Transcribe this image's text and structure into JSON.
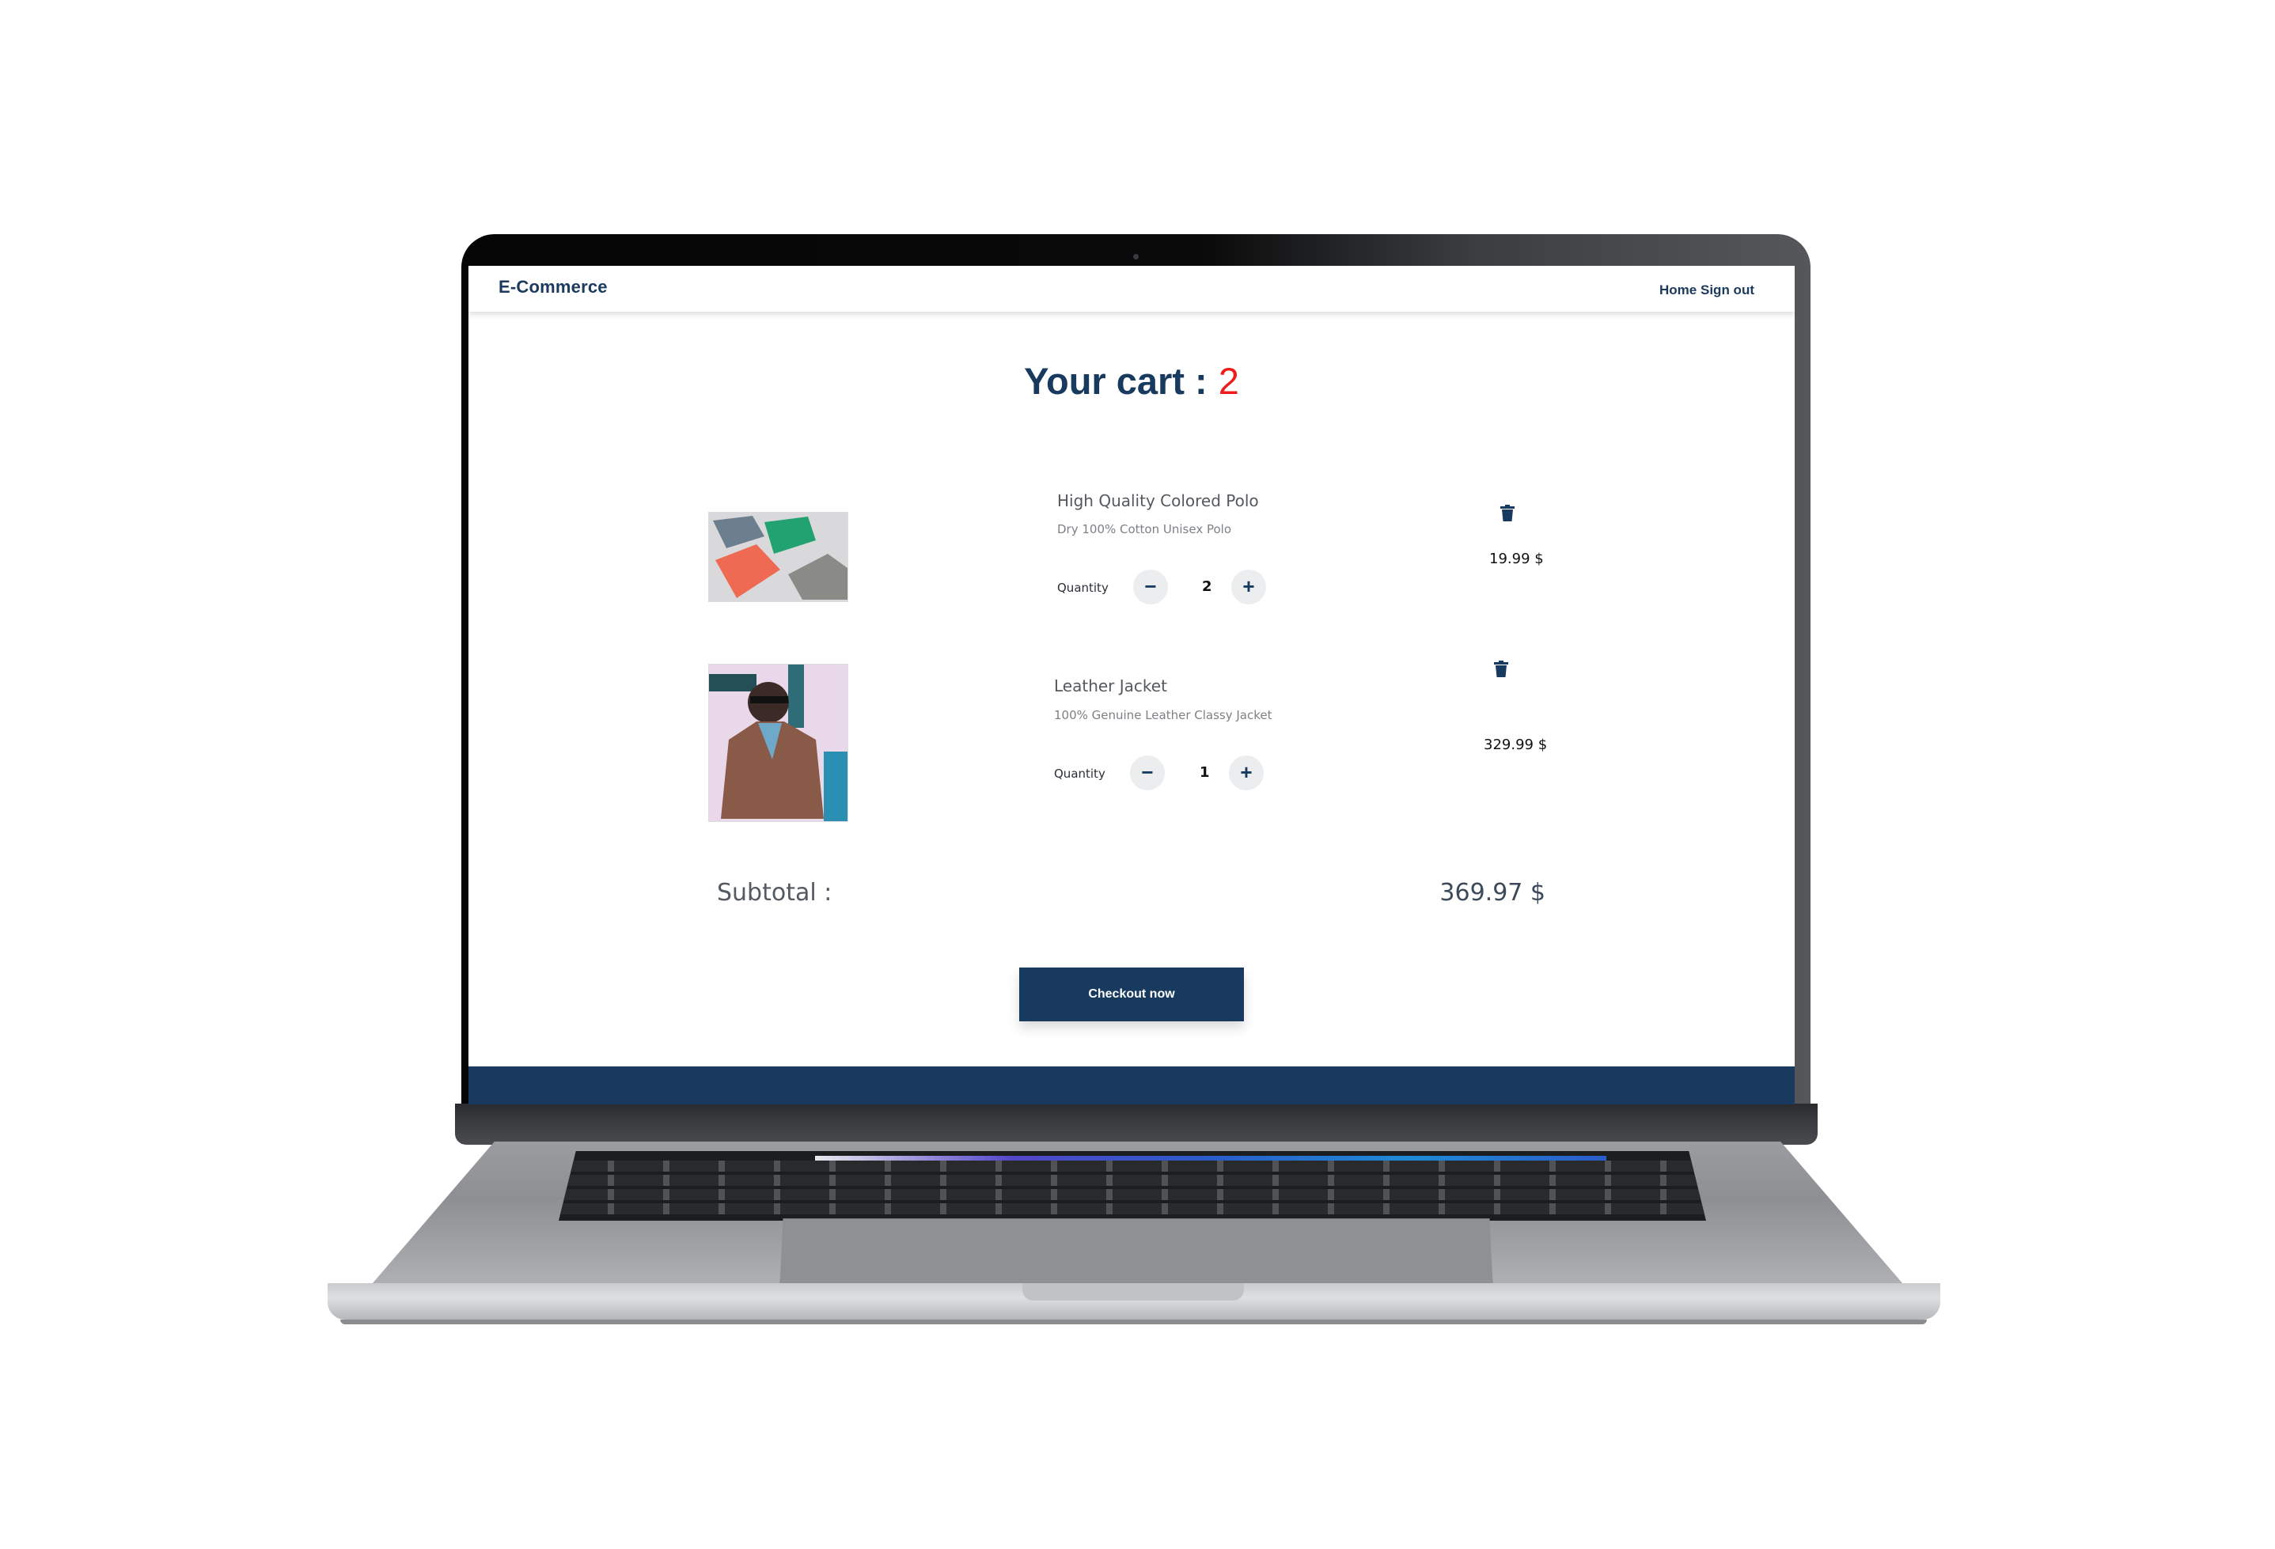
{
  "navbar": {
    "brand": "E-Commerce",
    "links": [
      {
        "label": "Home"
      },
      {
        "label": "Sign out"
      }
    ]
  },
  "cart": {
    "title": "Your cart :",
    "count": "2",
    "quantity_label": "Quantity",
    "items": [
      {
        "name": "High Quality Colored Polo",
        "description": "Dry 100% Cotton Unisex Polo",
        "quantity": "2",
        "price": "19.99 $",
        "image": "colored-polo-shirts-photo"
      },
      {
        "name": "Leather Jacket",
        "description": "100% Genuine Leather Classy Jacket",
        "quantity": "1",
        "price": "329.99 $",
        "image": "man-in-leather-jacket-photo"
      }
    ],
    "subtotal_label": "Subtotal :",
    "subtotal_value": "369.97 $",
    "checkout_label": "Checkout now"
  },
  "icons": {
    "minus": "−",
    "plus": "+",
    "trash": "trash-icon"
  },
  "colors": {
    "brand": "#173a5e",
    "count": "#ee1c1c",
    "footer": "#193a5e"
  }
}
